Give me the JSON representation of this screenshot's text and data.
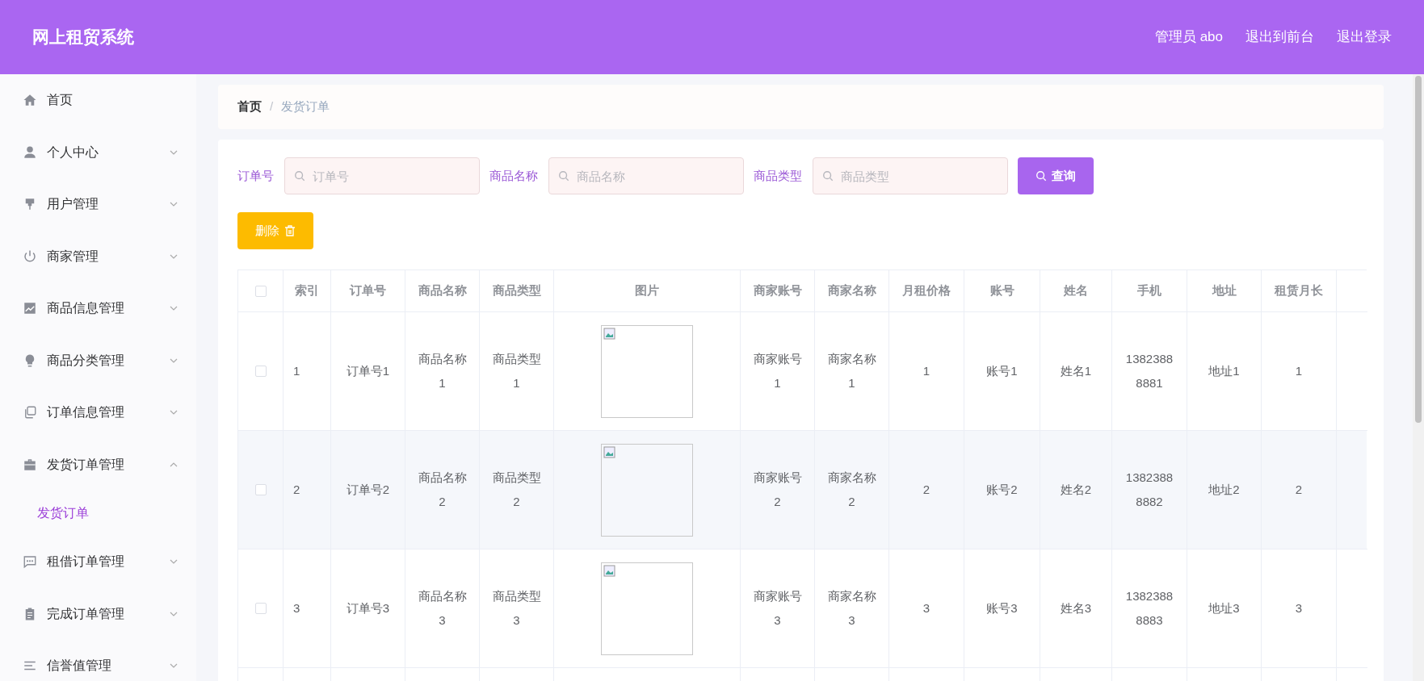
{
  "header": {
    "title": "网上租贸系统",
    "links": [
      "管理员 abo",
      "退出到前台",
      "退出登录"
    ]
  },
  "sidebar": {
    "items": [
      {
        "label": "首页"
      },
      {
        "label": "个人中心",
        "expanded": false
      },
      {
        "label": "用户管理",
        "expanded": false
      },
      {
        "label": "商家管理",
        "expanded": false
      },
      {
        "label": "商品信息管理",
        "expanded": false
      },
      {
        "label": "商品分类管理",
        "expanded": false
      },
      {
        "label": "订单信息管理",
        "expanded": false
      },
      {
        "label": "发货订单管理",
        "expanded": true,
        "children": [
          {
            "label": "发货订单",
            "selected": true
          }
        ]
      },
      {
        "label": "租借订单管理",
        "expanded": false
      },
      {
        "label": "完成订单管理",
        "expanded": false
      },
      {
        "label": "信誉值管理",
        "expanded": false
      }
    ]
  },
  "breadcrumb": [
    {
      "label": "首页",
      "selected": false
    },
    {
      "label": "发货订单",
      "selected": true
    }
  ],
  "breadcrumb_separator": "/",
  "search": {
    "fields": [
      {
        "label": "订单号",
        "placeholder": "订单号"
      },
      {
        "label": "商品名称",
        "placeholder": "商品名称"
      },
      {
        "label": "商品类型",
        "placeholder": "商品类型"
      }
    ],
    "button": "查询"
  },
  "delete_button": "删除",
  "table": {
    "header_checked": false,
    "columns": [
      "索引",
      "订单号",
      "商品名称",
      "商品类型",
      "图片",
      "商家账号",
      "商家名称",
      "月租价格",
      "账号",
      "姓名",
      "手机",
      "地址",
      "租赁月长"
    ],
    "rows": [
      {
        "checked": false,
        "cells": [
          "1",
          "订单号1",
          "商品名称1",
          "商品类型1",
          "",
          "商家账号1",
          "商家名称1",
          "1",
          "账号1",
          "姓名1",
          "13823888881",
          "地址1",
          "1"
        ]
      },
      {
        "checked": false,
        "cells": [
          "2",
          "订单号2",
          "商品名称2",
          "商品类型2",
          "",
          "商家账号2",
          "商家名称2",
          "2",
          "账号2",
          "姓名2",
          "13823888882",
          "地址2",
          "2"
        ]
      },
      {
        "checked": false,
        "cells": [
          "3",
          "订单号3",
          "商品名称3",
          "商品类型3",
          "",
          "商家账号3",
          "商家名称3",
          "3",
          "账号3",
          "姓名3",
          "13823888883",
          "地址3",
          "3"
        ]
      }
    ]
  }
}
